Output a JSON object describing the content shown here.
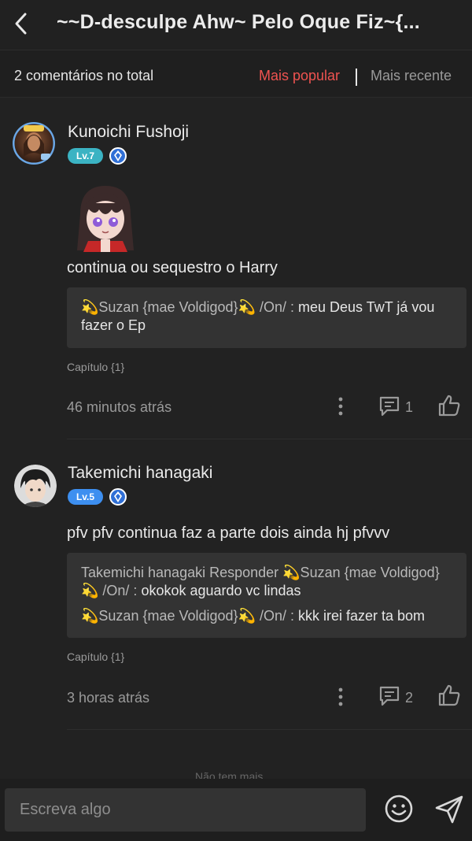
{
  "header": {
    "title": "~~D-desculpe Ahw~ Pelo Oque Fiz~{..."
  },
  "sortbar": {
    "total": "2 comentários no total",
    "popular": "Mais popular",
    "recent": "Mais recente"
  },
  "comments": [
    {
      "username": "Kunoichi Fushoji",
      "level": "Lv.7",
      "text": "continua ou sequestro o Harry",
      "replies": [
        {
          "author": "💫Suzan {mae Voldigod}💫 /On/ : ",
          "text": "meu Deus TwT já vou fazer o Ep"
        }
      ],
      "chapter": "Capítulo {1}",
      "time": "46 minutos atrás",
      "reply_count": "1"
    },
    {
      "username": "Takemichi hanagaki",
      "level": "Lv.5",
      "text": "pfv pfv continua faz a parte dois ainda hj pfvvv",
      "replies": [
        {
          "author": "Takemichi hanagaki Responder 💫Suzan {mae Voldigod}💫 /On/ : ",
          "text": "okokok aguardo vc lindas"
        },
        {
          "author": "💫Suzan {mae Voldigod}💫 /On/ : ",
          "text": "kkk irei fazer ta bom"
        }
      ],
      "chapter": "Capítulo {1}",
      "time": "3 horas atrás",
      "reply_count": "2"
    }
  ],
  "footer_partial": "Não tem mais",
  "input": {
    "placeholder": "Escreva algo"
  },
  "colors": {
    "accent_red": "#ef5350",
    "lv7_badge": "#3bb3c3",
    "lv5_badge": "#3d8ff0",
    "diamond_blue": "#2f6fd6",
    "background": "#222222"
  },
  "icons": [
    "back-arrow-icon",
    "more-vertical-icon",
    "comment-bubble-icon",
    "thumbs-up-icon",
    "emoji-icon",
    "send-icon",
    "diamond-icon"
  ]
}
